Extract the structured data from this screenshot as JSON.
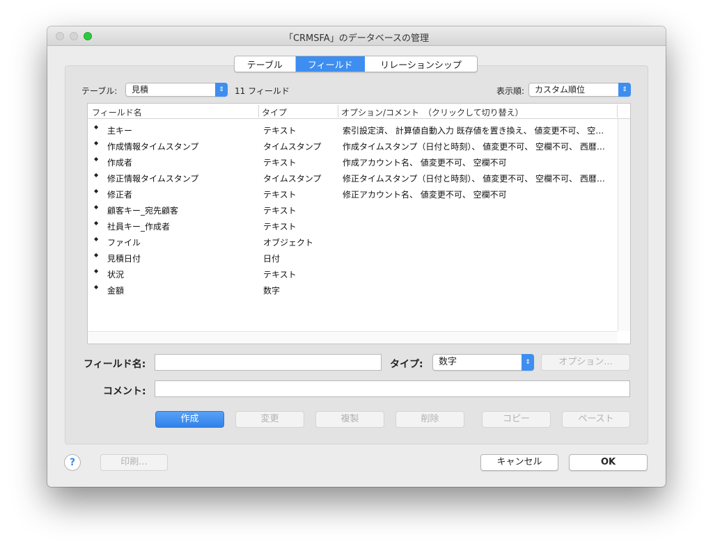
{
  "window": {
    "title": "「CRMSFA」のデータベースの管理"
  },
  "tabs": [
    {
      "label": "テーブル"
    },
    {
      "label": "フィールド"
    },
    {
      "label": "リレーションシップ"
    }
  ],
  "toolbar": {
    "table_label": "テーブル:",
    "table_value": "見積",
    "field_count": "11 フィールド",
    "sort_label": "表示順:",
    "sort_value": "カスタム順位"
  },
  "table": {
    "columns": [
      "フィールド名",
      "タイプ",
      "オプション/コメント　（クリックして切り替え）"
    ],
    "rows": [
      {
        "name": "主キー",
        "type": "テキスト",
        "options": "索引設定済、 計算値自動入力  既存値を置き換え、 値変更不可、 空…"
      },
      {
        "name": "作成情報タイムスタンプ",
        "type": "タイムスタンプ",
        "options": "作成タイムスタンプ（日付と時刻）、 値変更不可、 空欄不可、 西暦…"
      },
      {
        "name": "作成者",
        "type": "テキスト",
        "options": "作成アカウント名、 値変更不可、 空欄不可"
      },
      {
        "name": "修正情報タイムスタンプ",
        "type": "タイムスタンプ",
        "options": "修正タイムスタンプ（日付と時刻）、 値変更不可、 空欄不可、 西暦…"
      },
      {
        "name": "修正者",
        "type": "テキスト",
        "options": "修正アカウント名、 値変更不可、 空欄不可"
      },
      {
        "name": "顧客キー_宛先顧客",
        "type": "テキスト",
        "options": ""
      },
      {
        "name": "社員キー_作成者",
        "type": "テキスト",
        "options": ""
      },
      {
        "name": "ファイル",
        "type": "オブジェクト",
        "options": ""
      },
      {
        "name": "見積日付",
        "type": "日付",
        "options": ""
      },
      {
        "name": "状況",
        "type": "テキスト",
        "options": ""
      },
      {
        "name": "金額",
        "type": "数字",
        "options": ""
      }
    ]
  },
  "form": {
    "field_name_label": "フィールド名:",
    "field_name_value": "",
    "type_label": "タイプ:",
    "type_value": "数字",
    "options_button": "オプション...",
    "comment_label": "コメント:",
    "comment_value": ""
  },
  "actions": {
    "create": "作成",
    "change": "変更",
    "duplicate": "複製",
    "delete": "削除",
    "copy": "コピー",
    "paste": "ペースト"
  },
  "footer": {
    "help": "?",
    "print": "印刷...",
    "cancel": "キャンセル",
    "ok": "OK"
  },
  "colors": {
    "accent": "#3d8ef0",
    "zoom_button": "#2ec840"
  },
  "icons": {
    "row_handle": "updown-arrow-icon",
    "popup_arrow": "updown-chevron-icon"
  }
}
